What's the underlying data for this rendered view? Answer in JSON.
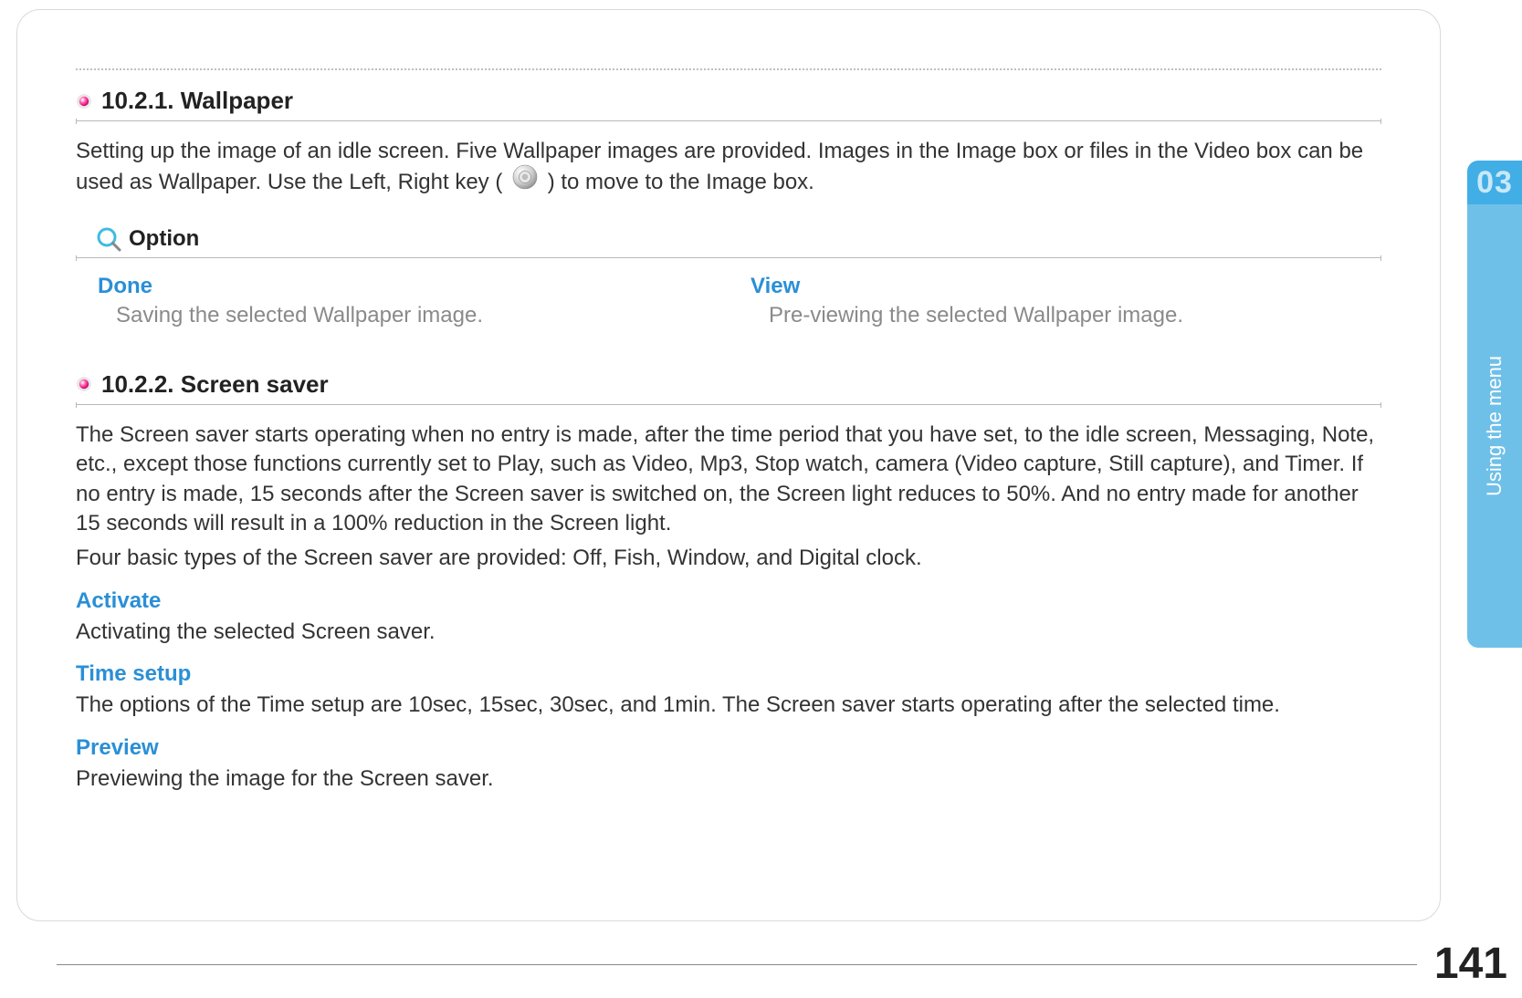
{
  "chapter": {
    "number": "03",
    "label": "Using the menu"
  },
  "page_number": "141",
  "sections": {
    "wallpaper": {
      "title": "10.2.1. Wallpaper",
      "desc_a": "Setting up the image of an idle screen. Five Wallpaper images are provided. Images in the Image box or files in the Video box can be used as Wallpaper. Use the Left, Right key (",
      "desc_b": ") to move to the Image box.",
      "option_label": "Option",
      "options": {
        "done": {
          "term": "Done",
          "desc": "Saving the selected Wallpaper image."
        },
        "view": {
          "term": "View",
          "desc": "Pre-viewing the selected Wallpaper image."
        }
      }
    },
    "screensaver": {
      "title": "10.2.2. Screen saver",
      "para1": "The Screen saver starts operating when no entry is made, after the time period that you have set, to the idle screen, Messaging, Note, etc., except those functions currently set to Play, such as Video, Mp3, Stop watch, camera (Video capture, Still capture), and Timer. If no entry is made, 15 seconds after the Screen saver is switched on, the Screen light reduces to 50%.  And no entry made for another 15 seconds will result in a 100% reduction in the Screen light.",
      "para2": "Four basic types of the Screen saver are provided: Off, Fish, Window, and Digital clock.",
      "entries": {
        "activate": {
          "term": "Activate",
          "desc": "Activating the selected Screen saver."
        },
        "time_setup": {
          "term": "Time setup",
          "desc": "The options of the Time setup are 10sec, 15sec, 30sec, and 1min. The Screen saver starts operating after the selected time."
        },
        "preview": {
          "term": "Preview",
          "desc": "Previewing the image for the Screen saver."
        }
      }
    }
  }
}
